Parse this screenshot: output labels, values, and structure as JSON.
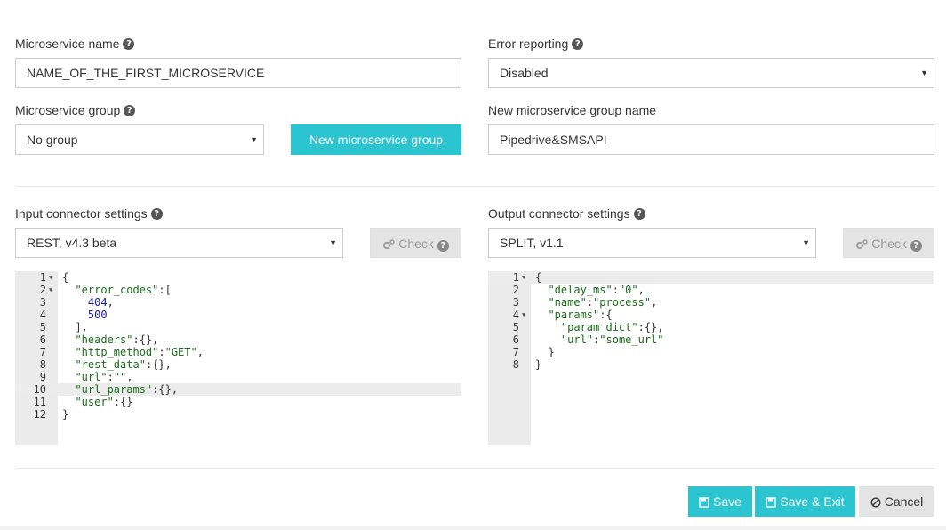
{
  "form": {
    "microservice_name": {
      "label": "Microservice name",
      "value": "NAME_OF_THE_FIRST_MICROSERVICE"
    },
    "error_reporting": {
      "label": "Error reporting",
      "value": "Disabled"
    },
    "microservice_group": {
      "label": "Microservice group",
      "value": "No group"
    },
    "new_group_button": "New microservice group",
    "new_group_name": {
      "label": "New microservice group name",
      "value": "Pipedrive&SMSAPI"
    }
  },
  "input_connector": {
    "label": "Input connector settings",
    "value": "REST, v4.3 beta",
    "check_label": "Check",
    "code": [
      {
        "n": "1",
        "fold": true,
        "text": "{"
      },
      {
        "n": "2",
        "fold": true,
        "text": "  \"error_codes\":["
      },
      {
        "n": "3",
        "fold": false,
        "text": "    404,"
      },
      {
        "n": "4",
        "fold": false,
        "text": "    500"
      },
      {
        "n": "5",
        "fold": false,
        "text": "  ],"
      },
      {
        "n": "6",
        "fold": false,
        "text": "  \"headers\":{},"
      },
      {
        "n": "7",
        "fold": false,
        "text": "  \"http_method\":\"GET\","
      },
      {
        "n": "8",
        "fold": false,
        "text": "  \"rest_data\":{},"
      },
      {
        "n": "9",
        "fold": false,
        "text": "  \"url\":\"\","
      },
      {
        "n": "10",
        "fold": false,
        "text": "  \"url_params\":{},"
      },
      {
        "n": "11",
        "fold": false,
        "text": "  \"user\":{}"
      },
      {
        "n": "12",
        "fold": false,
        "text": "}"
      }
    ]
  },
  "output_connector": {
    "label": "Output connector settings",
    "value": "SPLIT, v1.1",
    "check_label": "Check",
    "code": [
      {
        "n": "1",
        "fold": true,
        "text": "{"
      },
      {
        "n": "2",
        "fold": false,
        "text": "  \"delay_ms\":\"0\","
      },
      {
        "n": "3",
        "fold": false,
        "text": "  \"name\":\"process\","
      },
      {
        "n": "4",
        "fold": true,
        "text": "  \"params\":{"
      },
      {
        "n": "5",
        "fold": false,
        "text": "    \"param_dict\":{},"
      },
      {
        "n": "6",
        "fold": false,
        "text": "    \"url\":\"some_url\""
      },
      {
        "n": "7",
        "fold": false,
        "text": "  }"
      },
      {
        "n": "8",
        "fold": false,
        "text": "}"
      }
    ]
  },
  "actions": {
    "save": "Save",
    "save_exit": "Save & Exit",
    "cancel": "Cancel"
  },
  "colors": {
    "accent": "#2bc4d1"
  }
}
